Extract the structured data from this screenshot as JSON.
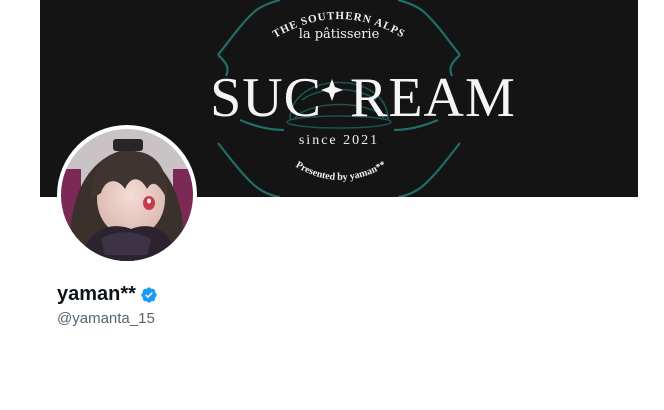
{
  "banner": {
    "arc_top": "THE SOUTHERN ALPS",
    "subtitle": "la pâtisserie",
    "brand_left": "SUC",
    "brand_right": "REAM",
    "since": "since 2021",
    "presented": "Presented by yaman**",
    "background_color": "#141414",
    "accent_color": "#1f6e6a"
  },
  "profile": {
    "display_name": "yaman**",
    "handle": "@yamanta_15",
    "verified": true,
    "verified_color": "#1d9bf0"
  }
}
